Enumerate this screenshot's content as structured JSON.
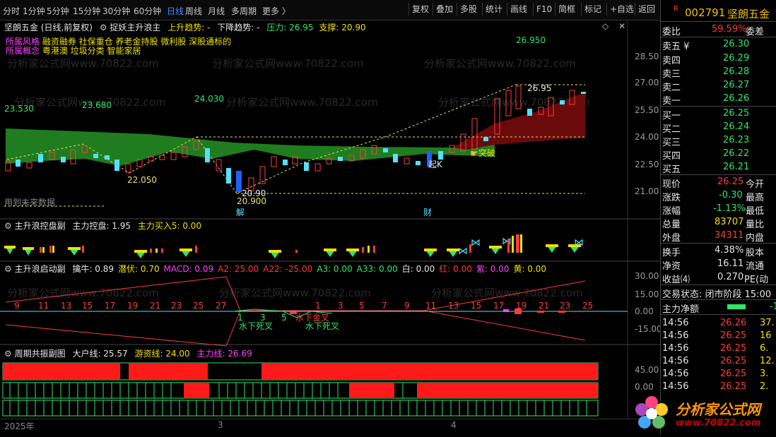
{
  "toolbar": {
    "periods": [
      "分时",
      "1分钟",
      "5分钟",
      "15分钟",
      "30分钟",
      "60分钟",
      "日线",
      "周线",
      "月线",
      "多周期",
      "更多 〉"
    ],
    "selected": "日线",
    "right_buttons": [
      "复权",
      "叠加",
      "多股",
      "统计",
      "画线",
      "F10",
      "简框",
      "标记",
      "+自选",
      "返回"
    ]
  },
  "main_chart": {
    "title": "坚朗五金 (日线,前复权)",
    "indicator_name": "捉妖主升浪主",
    "trend_up": "上升趋势: -",
    "trend_down": "下降趋势: -",
    "pressure": "压力: 26.95",
    "support": "支撑: 20.90",
    "sector_label": "所属风格",
    "sector_value": "融资融券 社保重仓 养老金持股 微利股 深股通标的",
    "concept_label": "所属概念",
    "concept_value": "粤港澳 垃圾分类 智能家居",
    "price_ticks": [
      "28.50",
      "27.00",
      "25.50",
      "24.00",
      "22.50",
      "21.00"
    ],
    "labels": {
      "l1": "23.530",
      "l2": "23.680",
      "l3": "24.030",
      "l4": "22.050",
      "l5": "20.900",
      "l6": "20.90",
      "l7": "26.950",
      "l8": "26.95",
      "buy": "起K",
      "breakout": "突破",
      "jie": "解",
      "cai": "财",
      "future": "用到未来数据"
    },
    "watermark": "分析家公式网www.70822.com"
  },
  "sub1": {
    "title": "主升浪控盘副",
    "f1": "主力控盘: 1.95",
    "f2": "主力买入5: 0.00"
  },
  "sub2": {
    "title": "主升浪启动副",
    "fields": [
      {
        "t": "擒牛: 0.89",
        "c": "#e6e6e6"
      },
      {
        "t": "潜伏: 0.70",
        "c": "#f0e000"
      },
      {
        "t": "MACD: 0.09",
        "c": "#ff40ff"
      },
      {
        "t": "A2: 25.00",
        "c": "#ff3b3b"
      },
      {
        "t": "A22: -25.00",
        "c": "#ff3b3b"
      },
      {
        "t": "A3: 0.00",
        "c": "#2ee66a"
      },
      {
        "t": "A33: 0.00",
        "c": "#2ee66a"
      },
      {
        "t": "白: 0.00",
        "c": "#e6e6e6"
      },
      {
        "t": "红: 0.00",
        "c": "#ff3b3b"
      },
      {
        "t": "紫: 0.00",
        "c": "#ff40ff"
      },
      {
        "t": "黄: 0.00",
        "c": "#f0e000"
      }
    ],
    "ticks": [
      "30.00",
      "15.00",
      "0.00",
      "-15.00"
    ],
    "counts_left": [
      "9",
      "11",
      "13",
      "15",
      "17",
      "19",
      "21",
      "23",
      "25",
      "27"
    ],
    "counts_mid": [
      "1",
      "3",
      "5",
      "1",
      "3",
      "5",
      "7"
    ],
    "counts_right": [
      "9",
      "11",
      "13",
      "15",
      "17",
      "19",
      "21",
      "23",
      "25"
    ],
    "cross1": "水下死叉",
    "cross2": "水下死叉",
    "cross3": "水下金叉"
  },
  "sub3": {
    "title": "周期共振副图",
    "f1": "大户线: 25.57",
    "f2": "游资线: 24.00",
    "f3": "主力线: 26.69",
    "ticks": [
      "45.00",
      "0.00"
    ]
  },
  "axis": {
    "year": "2025年",
    "m3": "3",
    "m4": "4"
  },
  "quote": {
    "code": "002791",
    "name": "坚朗五金",
    "r_badge": "R",
    "webi_label": "委比",
    "webi_value": "59.59%",
    "wecha_label": "委差",
    "asks": [
      {
        "label": "卖五 ¥",
        "price": "26.30"
      },
      {
        "label": "卖四",
        "price": "26.29"
      },
      {
        "label": "卖三",
        "price": "26.28"
      },
      {
        "label": "卖二",
        "price": "26.27"
      },
      {
        "label": "卖一",
        "price": "26.26"
      }
    ],
    "bids": [
      {
        "label": "买一",
        "price": "26.25"
      },
      {
        "label": "买二",
        "price": "26.24"
      },
      {
        "label": "买三",
        "price": "26.23"
      },
      {
        "label": "买四",
        "price": "26.22"
      },
      {
        "label": "买五",
        "price": "26.21"
      }
    ],
    "stats": [
      {
        "l": "现价",
        "v": "26.25",
        "r": "今开",
        "vc": "#ff3b3b"
      },
      {
        "l": "涨跌",
        "v": "-0.30",
        "r": "最高",
        "vc": "#2ee66a"
      },
      {
        "l": "涨幅",
        "v": "-1.13%",
        "r": "最低",
        "vc": "#2ee66a"
      },
      {
        "l": "总量",
        "v": "83707",
        "r": "量比",
        "vc": "#f0e000"
      },
      {
        "l": "外盘",
        "v": "34311",
        "r": "内盘",
        "vc": "#ff3b3b"
      }
    ],
    "stats2": [
      {
        "l": "换手",
        "v": "4.38%",
        "r": "股本"
      },
      {
        "l": "净资",
        "v": "16.11",
        "r": "流通"
      },
      {
        "l": "收益⑷",
        "v": "0.270",
        "r": "PE(动"
      }
    ],
    "trade_state": "交易状态: 闭市阶段 15:00",
    "net_label": "主力净额",
    "net_value": "-1",
    "ticks": [
      {
        "t": "14:56",
        "p": "26.26",
        "v": "37."
      },
      {
        "t": "14:56",
        "p": "26.25",
        "v": "16"
      },
      {
        "t": "14:56",
        "p": "26.25",
        "v": "6."
      },
      {
        "t": "14:56",
        "p": "26.25",
        "v": "12."
      },
      {
        "t": "14:56",
        "p": "26.25",
        "v": "3."
      },
      {
        "t": "14:56",
        "p": "26.25",
        "v": "2."
      }
    ]
  },
  "logo": {
    "text": "分析家公式网",
    "url": "www.70822.com"
  }
}
